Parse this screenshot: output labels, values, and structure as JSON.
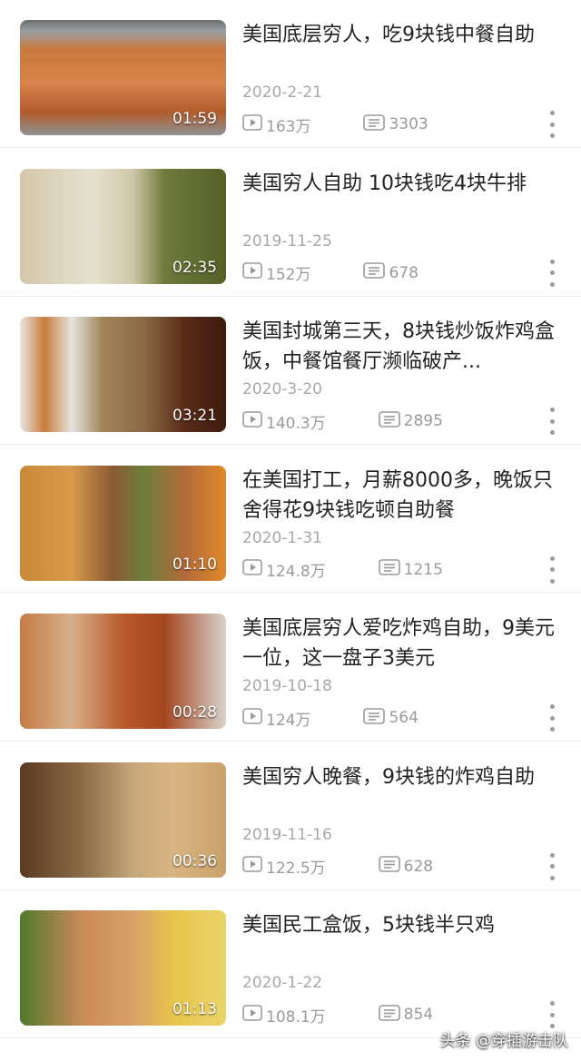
{
  "videos": [
    {
      "title": "美国底层穷人，吃9块钱中餐自助",
      "date": "2020-2-21",
      "duration": "01:59",
      "views": "163万",
      "comments": "3303",
      "thumb": "food-buffet-shrimp"
    },
    {
      "title": "美国穷人自助 10块钱吃4块牛排",
      "date": "2019-11-25",
      "duration": "02:35",
      "views": "152万",
      "comments": "678",
      "thumb": "food-cabbage-greenbeans"
    },
    {
      "title": "美国封城第三天，8块钱炒饭炸鸡盒饭，中餐馆餐厅濒临破产...",
      "date": "2020-3-20",
      "duration": "03:21",
      "views": "140.3万",
      "comments": "2895",
      "thumb": "food-friedrice-wings"
    },
    {
      "title": "在美国打工，月薪8000多，晚饭只舍得花9块钱吃顿自助餐",
      "date": "2020-1-31",
      "duration": "01:10",
      "views": "124.8万",
      "comments": "1215",
      "thumb": "food-friedchicken-beans"
    },
    {
      "title": "美国底层穷人爱吃炸鸡自助，9美元一位，这一盘子3美元",
      "date": "2019-10-18",
      "duration": "00:28",
      "views": "124万",
      "comments": "564",
      "thumb": "food-friedchicken-plate"
    },
    {
      "title": "美国穷人晚餐，9块钱的炸鸡自助",
      "date": "2019-11-16",
      "duration": "00:36",
      "views": "122.5万",
      "comments": "628",
      "thumb": "food-roastchicken"
    },
    {
      "title": "美国民工盒饭，5块钱半只鸡",
      "date": "2020-1-22",
      "duration": "01:13",
      "views": "108.1万",
      "comments": "854",
      "thumb": "food-chicken-corn"
    }
  ],
  "watermark": "头条 @穿插游击队",
  "icons": {
    "play": "play-icon",
    "comment": "comment-icon",
    "more": "more-vertical-icon"
  },
  "colors": {
    "title": "#222222",
    "meta": "#9a9a9a",
    "date": "#a8a8a8"
  }
}
